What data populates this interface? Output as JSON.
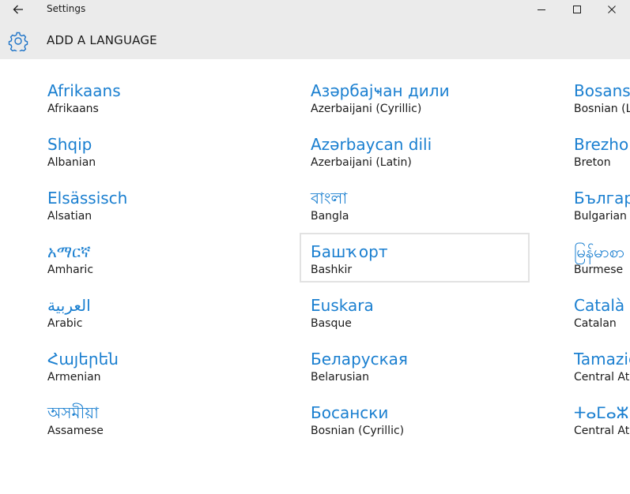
{
  "window": {
    "title": "Settings"
  },
  "header": {
    "title": "ADD A LANGUAGE"
  },
  "languages": [
    {
      "native": "Afrikaans",
      "english": "Afrikaans"
    },
    {
      "native": "Shqip",
      "english": "Albanian"
    },
    {
      "native": "Elsässisch",
      "english": "Alsatian"
    },
    {
      "native": "አማርኛ",
      "english": "Amharic"
    },
    {
      "native": "العربية",
      "english": "Arabic"
    },
    {
      "native": "Հայերեն",
      "english": "Armenian"
    },
    {
      "native": "অসমীয়া",
      "english": "Assamese"
    },
    {
      "native": "Азәрбајҹан дили",
      "english": "Azerbaijani (Cyrillic)"
    },
    {
      "native": "Azərbaycan dili",
      "english": "Azerbaijani (Latin)"
    },
    {
      "native": "বাংলা",
      "english": "Bangla"
    },
    {
      "native": "Башҡорт",
      "english": "Bashkir",
      "selected": true
    },
    {
      "native": "Euskara",
      "english": "Basque"
    },
    {
      "native": "Беларуская",
      "english": "Belarusian"
    },
    {
      "native": "Босански",
      "english": "Bosnian (Cyrillic)"
    },
    {
      "native": "Bosanski",
      "english": "Bosnian (Latin)"
    },
    {
      "native": "Brezhoneg",
      "english": "Breton"
    },
    {
      "native": "Български",
      "english": "Bulgarian"
    },
    {
      "native": "မြန်မာစာ",
      "english": "Burmese"
    },
    {
      "native": "Català",
      "english": "Catalan"
    },
    {
      "native": "Tamazight",
      "english": "Central Atlas Tamazight (Latin)"
    },
    {
      "native": "ⵜⴰⵎⴰⵣⵉⵖⵜ",
      "english": "Central Atlas Tamazight (Tifinagh)"
    }
  ]
}
